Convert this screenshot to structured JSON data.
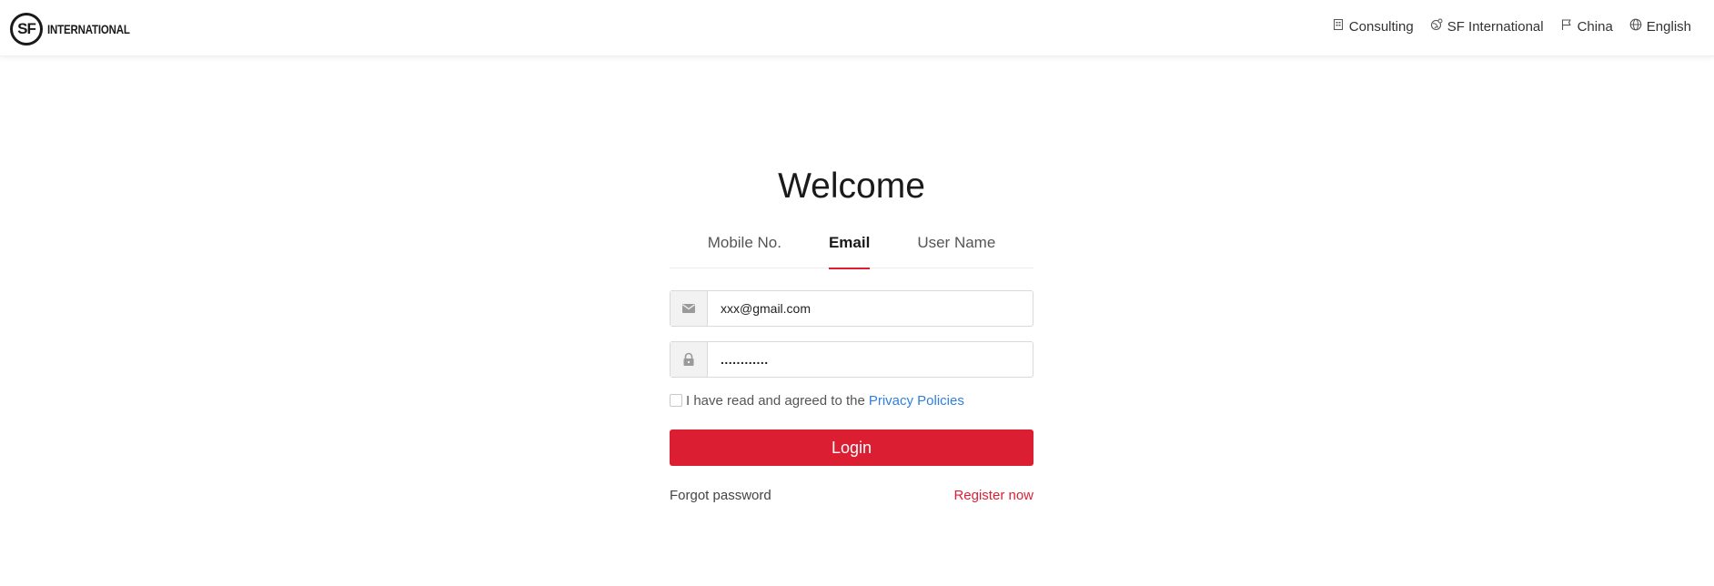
{
  "header": {
    "logo": {
      "mark": "SF",
      "text": "INTERNATIONAL"
    },
    "nav": [
      {
        "icon": "building-icon",
        "label": "Consulting"
      },
      {
        "icon": "globe-pin-icon",
        "label": "SF International"
      },
      {
        "icon": "flag-icon",
        "label": "China"
      },
      {
        "icon": "globe-icon",
        "label": "English"
      }
    ]
  },
  "login": {
    "title": "Welcome",
    "tabs": [
      {
        "label": "Mobile No.",
        "active": false
      },
      {
        "label": "Email",
        "active": true
      },
      {
        "label": "User Name",
        "active": false
      }
    ],
    "email": {
      "icon": "mail-icon",
      "value": "xxx@gmail.com"
    },
    "password": {
      "icon": "lock-icon",
      "value": "............"
    },
    "agreement": {
      "checked": false,
      "text": "I have read and agreed to the",
      "link": "Privacy Policies"
    },
    "login_label": "Login",
    "forgot_label": "Forgot password",
    "register_label": "Register now"
  },
  "colors": {
    "brand_red": "#dc1e32",
    "link_blue": "#2f7fe0"
  }
}
